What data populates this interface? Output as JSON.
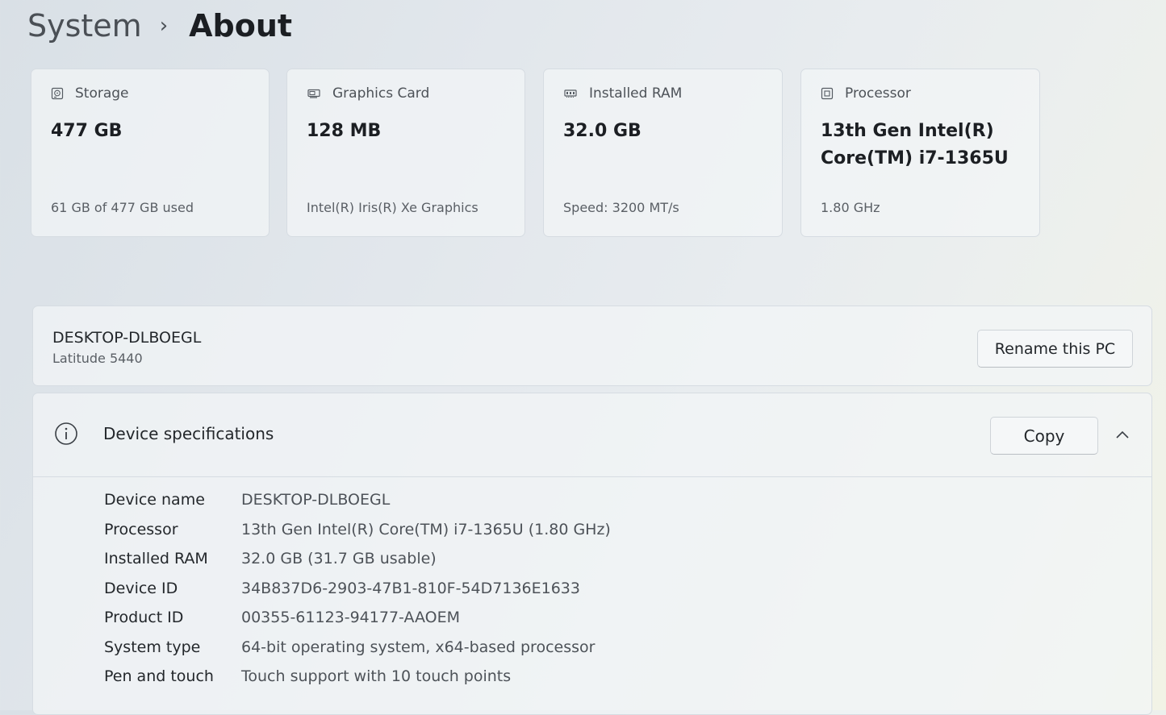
{
  "breadcrumb": {
    "parent": "System",
    "separator": "›",
    "current": "About"
  },
  "cards": [
    {
      "icon": "storage-icon",
      "label": "Storage",
      "value": "477 GB",
      "sub": "61 GB of 477 GB used"
    },
    {
      "icon": "graphics-card-icon",
      "label": "Graphics Card",
      "value": "128 MB",
      "sub": "Intel(R) Iris(R) Xe Graphics"
    },
    {
      "icon": "ram-icon",
      "label": "Installed RAM",
      "value": "32.0 GB",
      "sub": "Speed: 3200 MT/s"
    },
    {
      "icon": "processor-icon",
      "label": "Processor",
      "value": "13th Gen Intel(R) Core(TM) i7-1365U",
      "sub": "1.80 GHz"
    }
  ],
  "pc": {
    "name": "DESKTOP-DLBOEGL",
    "model": "Latitude 5440",
    "rename_label": "Rename this PC"
  },
  "device_specs": {
    "title": "Device specifications",
    "copy_label": "Copy",
    "rows": [
      {
        "label": "Device name",
        "value": "DESKTOP-DLBOEGL"
      },
      {
        "label": "Processor",
        "value": "13th Gen Intel(R) Core(TM) i7-1365U (1.80 GHz)"
      },
      {
        "label": "Installed RAM",
        "value": "32.0 GB (31.7 GB usable)"
      },
      {
        "label": "Device ID",
        "value": "34B837D6-2903-47B1-810F-54D7136E1633"
      },
      {
        "label": "Product ID",
        "value": "00355-61123-94177-AAOEM"
      },
      {
        "label": "System type",
        "value": "64-bit operating system, x64-based processor"
      },
      {
        "label": "Pen and touch",
        "value": "Touch support with 10 touch points"
      }
    ]
  }
}
